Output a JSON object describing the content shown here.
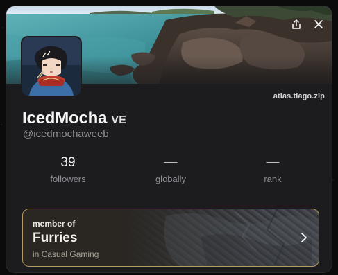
{
  "profile": {
    "display_name": "IcedMocha",
    "badge": "VE",
    "handle": "@icedmochaweeb",
    "domain": "atlas.tiago.zip"
  },
  "banner": {
    "description_icon": "landscape-photo"
  },
  "header_actions": {
    "share_icon": "share-icon",
    "close_icon": "close-icon"
  },
  "stats": [
    {
      "value": "39",
      "label": "followers"
    },
    {
      "value": "—",
      "label": "globally"
    },
    {
      "value": "—",
      "label": "rank"
    }
  ],
  "membership": {
    "eyebrow": "member of",
    "group": "Furries",
    "context": "in Casual Gaming",
    "accent_border": "#b89a63"
  },
  "colors": {
    "card_background": "#1c1c1e",
    "text_primary": "#f4f4f5",
    "text_muted": "#8c8c93"
  }
}
